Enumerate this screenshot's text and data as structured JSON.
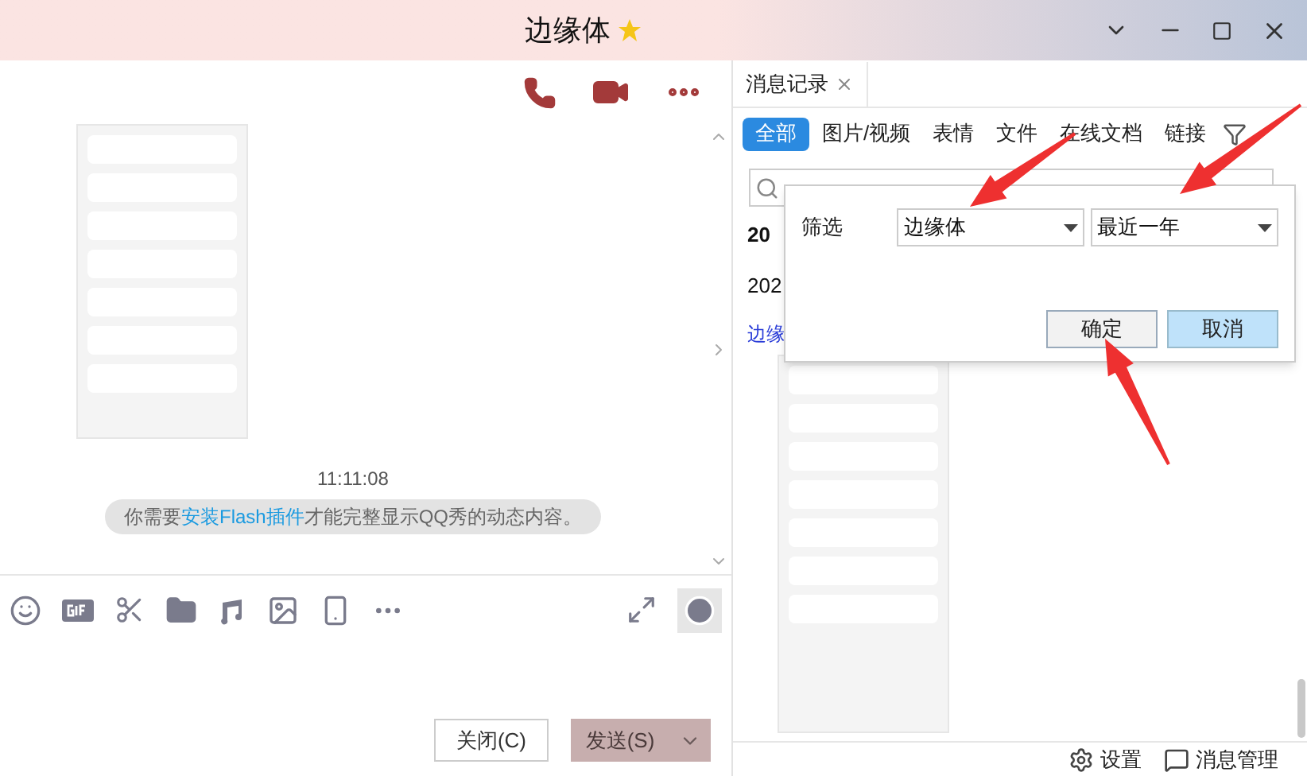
{
  "window": {
    "title": "边缘体"
  },
  "chat": {
    "timestamp": "11:11:08",
    "notice": {
      "before": "你需要",
      "link": "安装Flash插件",
      "after": "才能完整显示QQ秀的动态内容。"
    }
  },
  "compose": {
    "close_button": "关闭(C)",
    "send_button": "发送(S)"
  },
  "history": {
    "tab_title": "消息记录",
    "filter_tabs": [
      {
        "label": "全部",
        "selected": true
      },
      {
        "label": "图片/视频",
        "selected": false
      },
      {
        "label": "表情",
        "selected": false
      },
      {
        "label": "文件",
        "selected": false
      },
      {
        "label": "在线文档",
        "selected": false
      },
      {
        "label": "链接",
        "selected": false
      }
    ],
    "dates": [
      "20",
      "202"
    ],
    "sender": "边缘"
  },
  "filter_popup": {
    "label": "筛选",
    "contact": "边缘体",
    "range": "最近一年",
    "ok": "确定",
    "cancel": "取消"
  },
  "footer": {
    "settings": "设置",
    "manage": "消息管理"
  }
}
